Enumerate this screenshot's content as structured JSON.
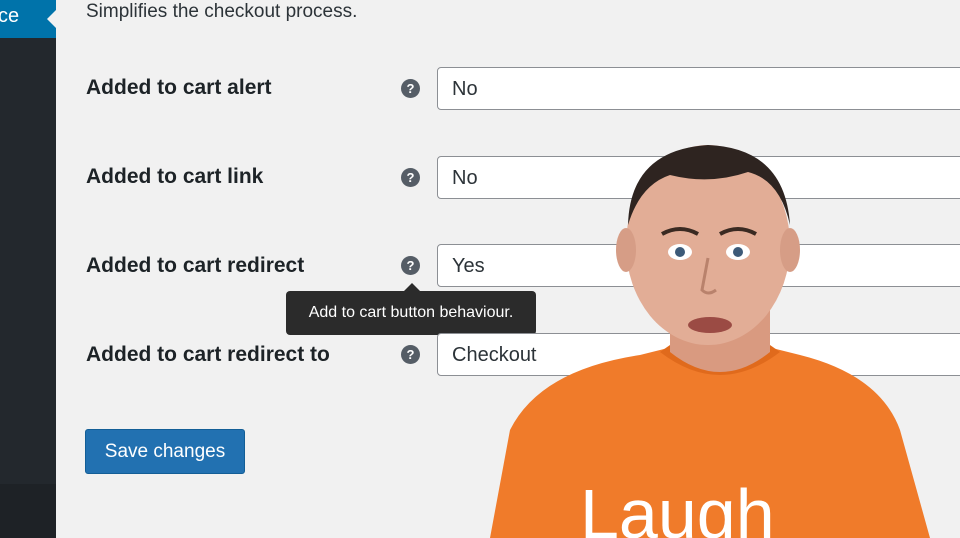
{
  "sidebar": {
    "active_item_label": "ce"
  },
  "section": {
    "description": "Simplifies the checkout process."
  },
  "fields": [
    {
      "label": "Added to cart alert",
      "value": "No"
    },
    {
      "label": "Added to cart link",
      "value": "No"
    },
    {
      "label": "Added to cart redirect",
      "value": "Yes"
    },
    {
      "label": "Added to cart redirect to",
      "value": "Checkout"
    }
  ],
  "tooltip": {
    "text": "Add to cart button behaviour."
  },
  "actions": {
    "save_label": "Save changes"
  },
  "presenter": {
    "shirt_text": "Laugh",
    "shirt_color": "#f07b2a"
  },
  "colors": {
    "accent": "#2271b1",
    "sidebar": "#23282d",
    "active": "#0073aa"
  }
}
